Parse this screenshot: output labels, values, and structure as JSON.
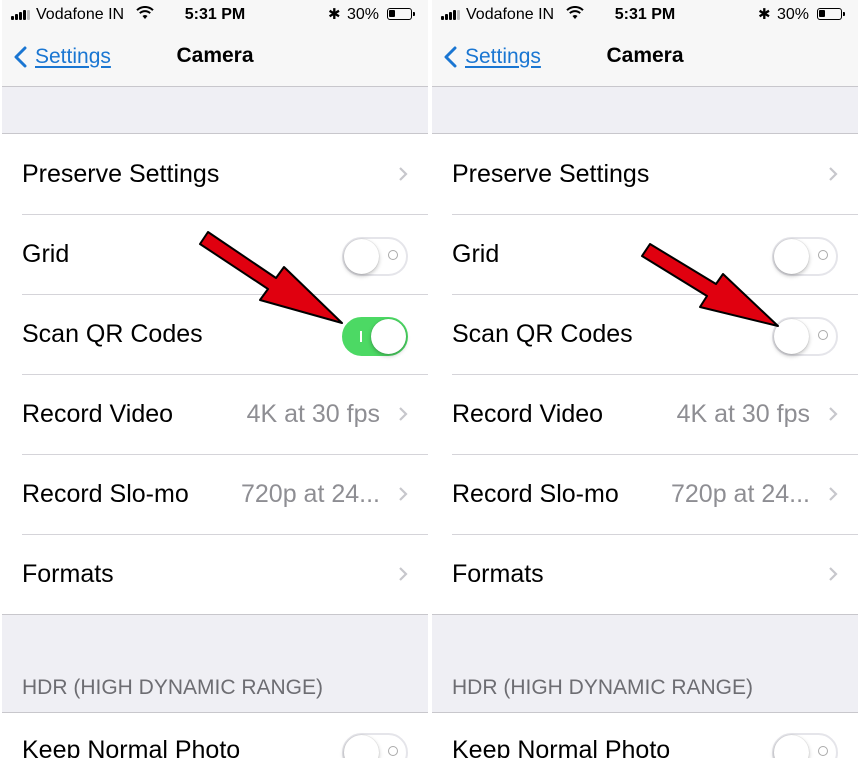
{
  "status_bar": {
    "carrier": "Vodafone IN",
    "time": "5:31 PM",
    "battery_percent": "30%",
    "icons": [
      "signal-icon",
      "wifi-icon",
      "bluetooth-icon",
      "battery-icon"
    ]
  },
  "nav": {
    "back_label": "Settings",
    "title": "Camera"
  },
  "section_header": "HDR (HIGH DYNAMIC RANGE)",
  "panels": [
    {
      "rows": [
        {
          "label": "Preserve Settings",
          "detail": ""
        },
        {
          "label": "Grid",
          "toggle": false
        },
        {
          "label": "Scan QR Codes",
          "toggle": true
        },
        {
          "label": "Record Video",
          "detail": "4K at 30 fps"
        },
        {
          "label": "Record Slo-mo",
          "detail": "720p at 24..."
        },
        {
          "label": "Formats",
          "detail": ""
        }
      ],
      "hdr_row": {
        "label": "Keep Normal Photo",
        "toggle": false
      }
    },
    {
      "rows": [
        {
          "label": "Preserve Settings",
          "detail": ""
        },
        {
          "label": "Grid",
          "toggle": false
        },
        {
          "label": "Scan QR Codes",
          "toggle": false
        },
        {
          "label": "Record Video",
          "detail": "4K at 30 fps"
        },
        {
          "label": "Record Slo-mo",
          "detail": "720p at 24..."
        },
        {
          "label": "Formats",
          "detail": ""
        }
      ],
      "hdr_row": {
        "label": "Keep Normal Photo",
        "toggle": false
      }
    }
  ],
  "colors": {
    "accent": "#1a76d2",
    "toggle_on": "#4cd964",
    "arrow": "#e0000f",
    "background": "#efeff4"
  }
}
